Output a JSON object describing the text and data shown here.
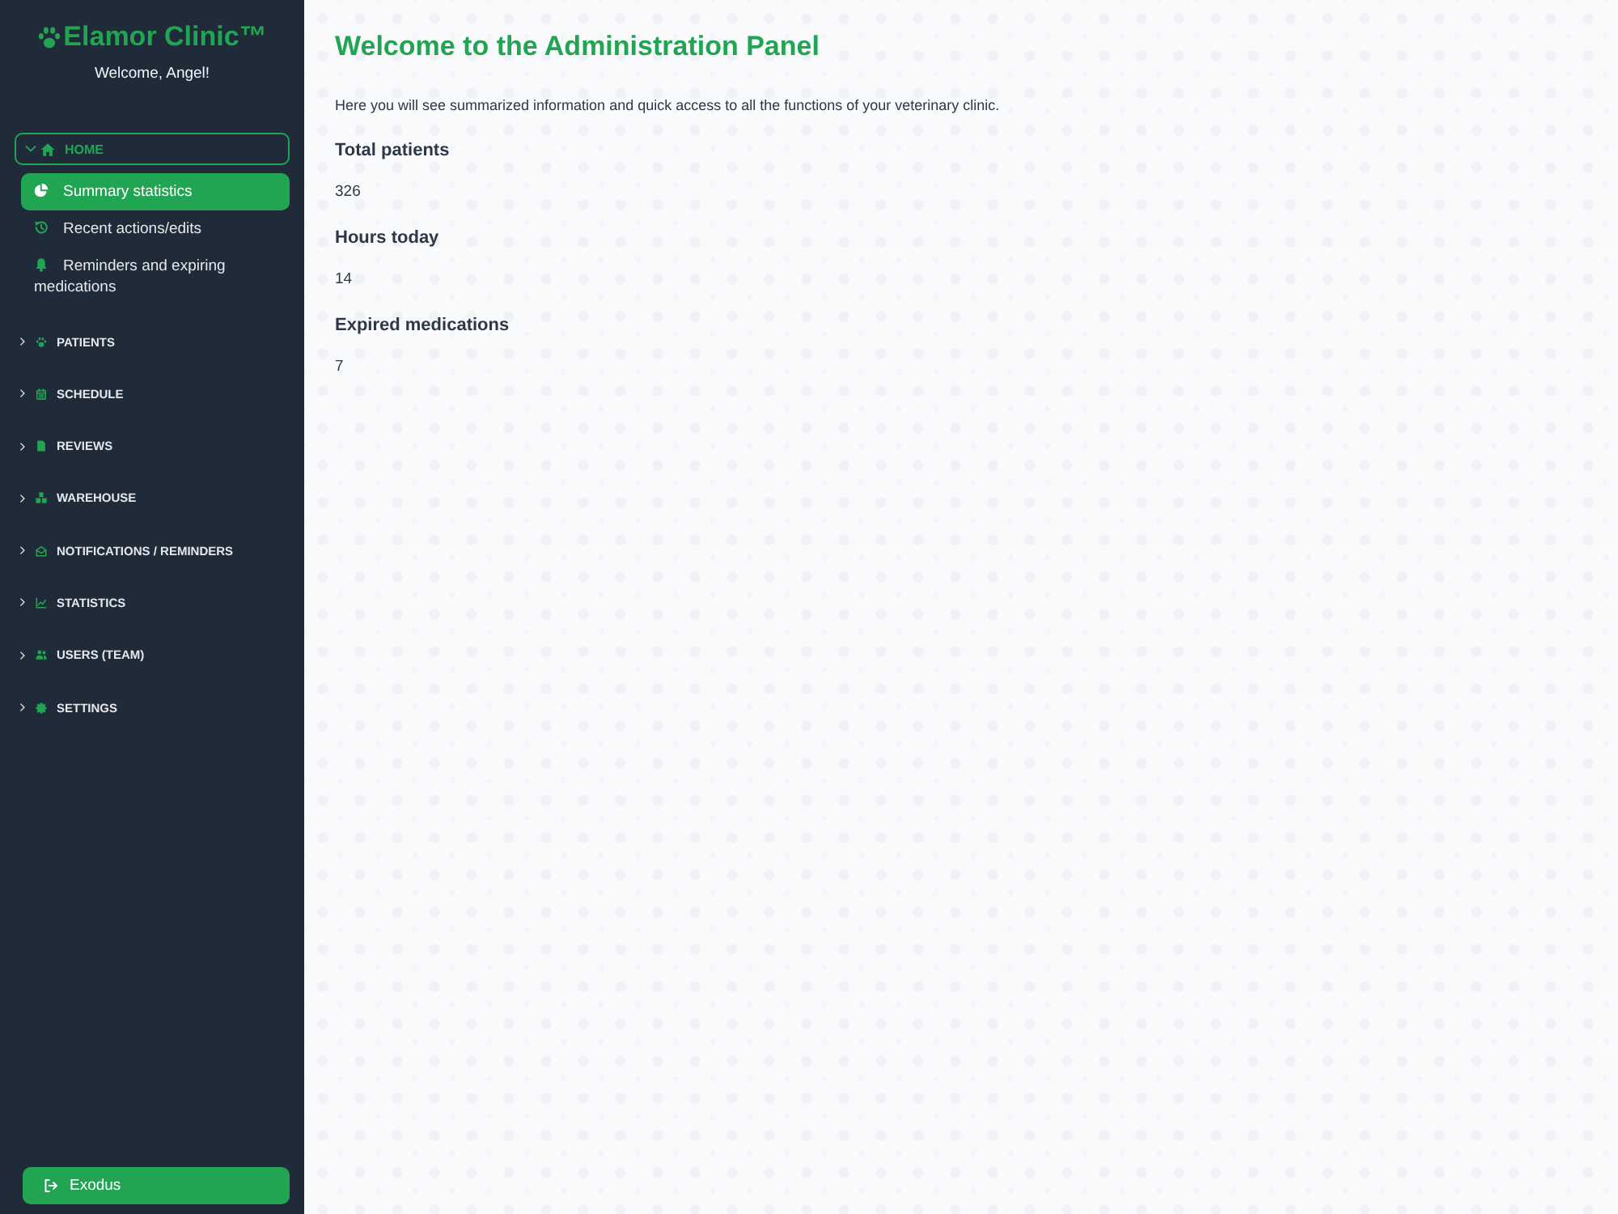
{
  "sidebar": {
    "brand": "Elamor Clinic™",
    "greeting": "Welcome, Angel!",
    "nav": [
      {
        "label": "HOME",
        "selected": true,
        "expanded": true,
        "children": [
          {
            "label": "Summary statistics",
            "selected": true
          },
          {
            "label": "Recent actions/edits",
            "selected": false
          },
          {
            "label": "Reminders and expiring medications",
            "selected": false
          }
        ]
      },
      {
        "label": "PATIENTS",
        "selected": false,
        "expanded": false
      },
      {
        "label": "SCHEDULE",
        "selected": false,
        "expanded": false
      },
      {
        "label": "REVIEWS",
        "selected": false,
        "expanded": false
      },
      {
        "label": "WAREHOUSE",
        "selected": false,
        "expanded": false
      },
      {
        "label": "NOTIFICATIONS / REMINDERS",
        "selected": false,
        "expanded": false
      },
      {
        "label": "STATISTICS",
        "selected": false,
        "expanded": false
      },
      {
        "label": "USERS (TEAM)",
        "selected": false,
        "expanded": false
      },
      {
        "label": "SETTINGS",
        "selected": false,
        "expanded": false
      }
    ],
    "logout": {
      "label": "Exodus"
    }
  },
  "main": {
    "title": "Welcome to the Administration Panel",
    "intro": "Here you will see summarized information and quick access to all the functions of your veterinary clinic.",
    "stats": [
      {
        "label": "Total patients",
        "value": "326"
      },
      {
        "label": "Hours today",
        "value": "14"
      },
      {
        "label": "Expired medications",
        "value": "7"
      }
    ]
  }
}
